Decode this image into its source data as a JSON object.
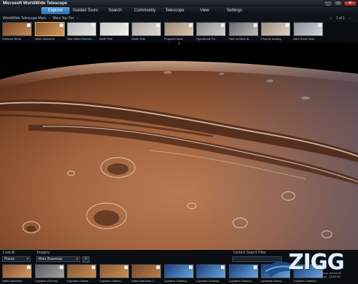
{
  "window": {
    "title": "Microsoft WorldWide Telescope",
    "buttons": {
      "minimize": "_",
      "maximize": "□",
      "close": "X"
    }
  },
  "nav": {
    "tabs": [
      {
        "label": "Explore",
        "active": true
      },
      {
        "label": "Guided Tours",
        "active": false
      },
      {
        "label": "Search",
        "active": false
      },
      {
        "label": "Community",
        "active": false
      },
      {
        "label": "Telescope",
        "active": false
      },
      {
        "label": "View",
        "active": false
      },
      {
        "label": "Settings",
        "active": false
      }
    ]
  },
  "breadcrumb": {
    "items": [
      "WorldWide Telescope Mars",
      "Mars Top Ten"
    ],
    "separator": "›",
    "pager": {
      "prev": "‹",
      "text": "1 of 1",
      "next": "›"
    }
  },
  "top_collection": {
    "items": [
      {
        "label": "Olympus Mons",
        "selected": false,
        "colors": [
          "#7a4a2a",
          "#c28a5a"
        ]
      },
      {
        "label": "Valles Marineris",
        "selected": true,
        "colors": [
          "#8a5530",
          "#d19a62"
        ]
      },
      {
        "label": "Gale (Mars Science...",
        "selected": false,
        "colors": [
          "#b2b7bd",
          "#e8e4dc"
        ]
      },
      {
        "label": "North Pole",
        "selected": false,
        "colors": [
          "#c9c7c2",
          "#f2f0ec"
        ]
      },
      {
        "label": "South Pole",
        "selected": false,
        "colors": [
          "#a8a39b",
          "#e0ddd6"
        ]
      },
      {
        "label": "Proposed landi...",
        "selected": false,
        "colors": [
          "#9c8a74",
          "#d7c7ad"
        ]
      },
      {
        "label": "Opportunity Ro...",
        "selected": false,
        "colors": [
          "#8c8c8c",
          "#d0d0d0"
        ]
      },
      {
        "label": "Face on Mars at...",
        "selected": false,
        "colors": [
          "#6b6b6b",
          "#bdbdbd"
        ]
      },
      {
        "label": "Phoenix landing...",
        "selected": false,
        "colors": [
          "#9e8f7e",
          "#dcd2c6"
        ]
      },
      {
        "label": "Spirit Rover land...",
        "selected": false,
        "colors": [
          "#8a8f96",
          "#d4d8dc"
        ]
      }
    ]
  },
  "controls": {
    "look_at_label": "Look At",
    "look_at_value": "Planet",
    "imagery_label": "Imagery",
    "imagery_value": "Mars Basemap",
    "imagery_button": "+",
    "context_filter_label": "Context Search Filter",
    "context_filter_value": ""
  },
  "bottom_collection": {
    "items": [
      {
        "label": "Valles Marineris",
        "colors": [
          "#8a5530",
          "#d19a62"
        ]
      },
      {
        "label": "Coprates (100 km)",
        "colors": [
          "#5c5c60",
          "#a5a3a0"
        ]
      },
      {
        "label": "Coprates Catena...",
        "colors": [
          "#8a5a32",
          "#c68c56"
        ]
      },
      {
        "label": "Coprates Catena...",
        "colors": [
          "#8c5b33",
          "#c98e58"
        ]
      },
      {
        "label": "Valles Marineris 1...",
        "colors": [
          "#7d4d2b",
          "#b77d4d"
        ]
      },
      {
        "label": "Coprates Chasma...",
        "colors": [
          "#1a3f7a",
          "#6aa9e0"
        ]
      },
      {
        "label": "Coprates Chasma...",
        "colors": [
          "#1a3f7a",
          "#6aa9e0"
        ]
      },
      {
        "label": "Coprates Chasma...",
        "colors": [
          "#1a3f7a",
          "#6aa9e0"
        ]
      },
      {
        "label": "Landslide depos...",
        "colors": [
          "#1a3f7a",
          "#6aa9e0"
        ]
      },
      {
        "label": "Coprates Chasma...",
        "colors": [
          "#1a3f7a",
          "#6aa9e0"
        ]
      }
    ]
  },
  "status": {
    "lng": "Lng: -62:41:20",
    "lat": "Lat: -13:52:30"
  },
  "watermark": {
    "text": "ZIGG"
  },
  "colors": {
    "accent": "#3d86c6",
    "selected_border": "#d9b45a",
    "mars_dark": "#6b3a22",
    "mars_light": "#c98e61"
  }
}
